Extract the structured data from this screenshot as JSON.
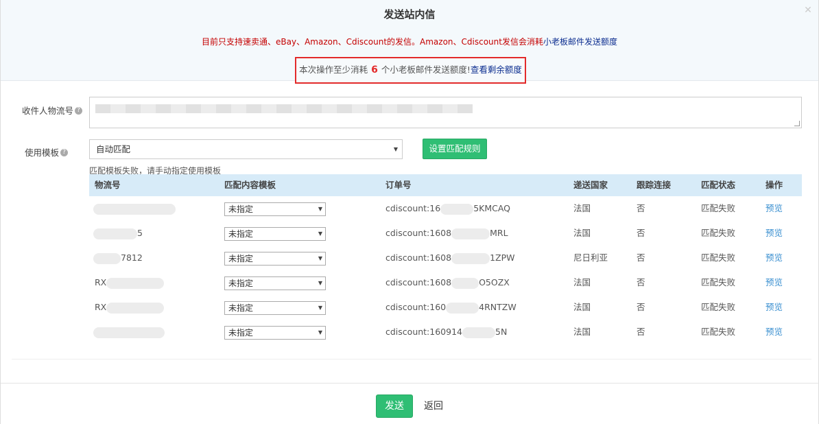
{
  "dialog": {
    "title": "发送站内信",
    "close_glyph": "✕",
    "notice_prefix": "目前只支持速卖通、eBay、Amazon、Cdiscount的发信。Amazon、Cdiscount发信会消耗",
    "notice_link": "小老板邮件发送额度",
    "quota_prefix": "本次操作至少消耗",
    "quota_number": "6",
    "quota_suffix": "个小老板邮件发送额度!",
    "quota_link": "查看剩余额度"
  },
  "form": {
    "recipient_label": "收件人物流号",
    "template_label": "使用模板",
    "template_value": "自动匹配",
    "set_rule_button": "设置匹配规则",
    "fail_tip": "匹配模板失败，请手动指定使用模板",
    "help_glyph": "?"
  },
  "table": {
    "headers": [
      "物流号",
      "匹配内容模板",
      "订单号",
      "递送国家",
      "跟踪连接",
      "匹配状态",
      "操作"
    ],
    "rows": [
      {
        "tracking": "",
        "template": "未指定",
        "order_prefix": "cdiscount:16",
        "order_suffix": "5KMCAQ",
        "country": "法国",
        "track_link": "否",
        "status": "匹配失败",
        "action": "预览"
      },
      {
        "tracking": "5",
        "template": "未指定",
        "order_prefix": "cdiscount:1608",
        "order_suffix": "MRL",
        "country": "法国",
        "track_link": "否",
        "status": "匹配失败",
        "action": "预览"
      },
      {
        "tracking": "7812",
        "template": "未指定",
        "order_prefix": "cdiscount:1608",
        "order_suffix": "1ZPW",
        "country": "尼日利亚",
        "track_link": "否",
        "status": "匹配失败",
        "action": "预览"
      },
      {
        "tracking": "RX",
        "template": "未指定",
        "order_prefix": "cdiscount:1608",
        "order_suffix": "O5OZX",
        "country": "法国",
        "track_link": "否",
        "status": "匹配失败",
        "action": "预览"
      },
      {
        "tracking": "RX",
        "template": "未指定",
        "order_prefix": "cdiscount:160",
        "order_suffix": "4RNTZW",
        "country": "法国",
        "track_link": "否",
        "status": "匹配失败",
        "action": "预览"
      },
      {
        "tracking": "",
        "template": "未指定",
        "order_prefix": "cdiscount:160914",
        "order_suffix": "5N",
        "country": "法国",
        "track_link": "否",
        "status": "匹配失败",
        "action": "预览"
      }
    ]
  },
  "footer": {
    "send_button": "发送",
    "back_button": "返回"
  },
  "icons": {
    "caret": "▼"
  }
}
